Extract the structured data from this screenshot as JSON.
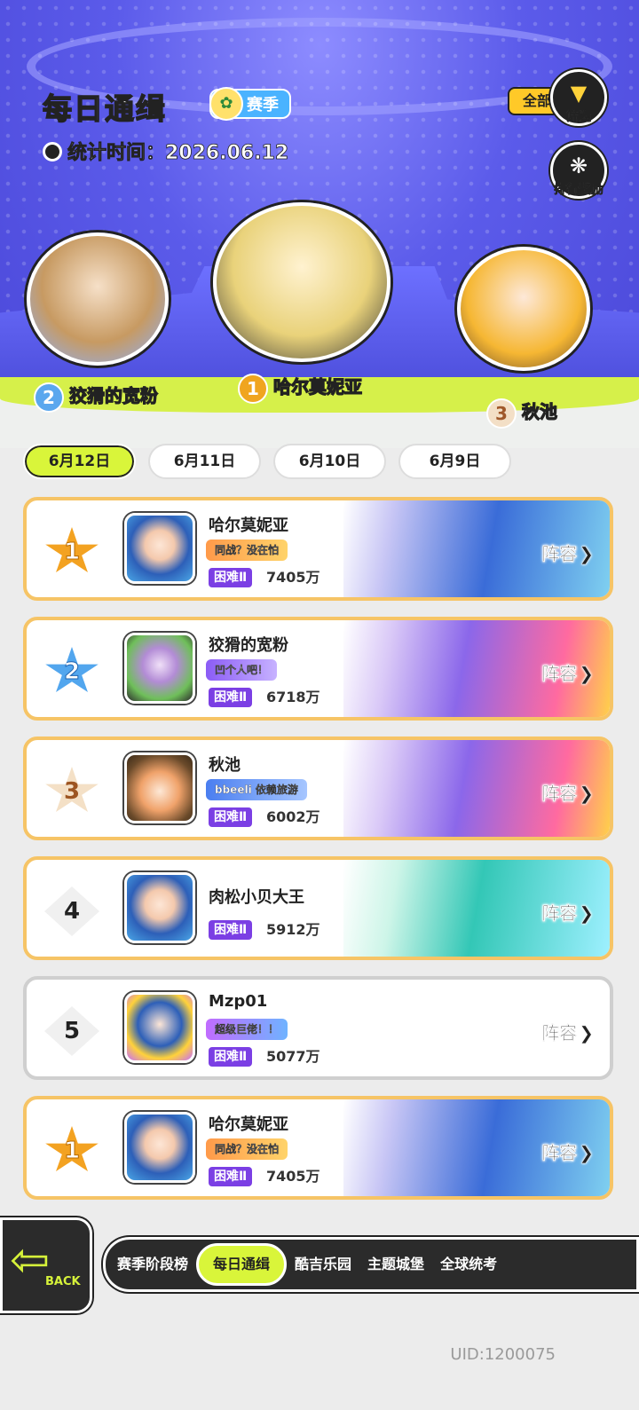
{
  "header": {
    "title": "每日通缉",
    "season_badge": "赛季",
    "stat_time_label": "统计时间：2026.06.12",
    "filter_all": "全部",
    "filter_label": "筛选",
    "reward_label": "排行奖励"
  },
  "podium": [
    {
      "rank": "2",
      "name": "狡猾的宽粉"
    },
    {
      "rank": "1",
      "name": "哈尔莫妮亚"
    },
    {
      "rank": "3",
      "name": "秋池"
    }
  ],
  "date_tabs": [
    "6月12日",
    "6月11日",
    "6月10日",
    "6月9日"
  ],
  "date_tab_active": "6月12日",
  "ranks": [
    {
      "rank": "1",
      "name": "哈尔莫妮亚",
      "tag": "同战？没在怕",
      "difficulty": "困难Ⅱ",
      "score": "7405万",
      "lineup": "阵容"
    },
    {
      "rank": "2",
      "name": "狡猾的宽粉",
      "tag": "凹个人吧！",
      "difficulty": "困难Ⅱ",
      "score": "6718万",
      "lineup": "阵容"
    },
    {
      "rank": "3",
      "name": "秋池",
      "tag": "bbeeli 依赖旅游",
      "difficulty": "困难Ⅱ",
      "score": "6002万",
      "lineup": "阵容"
    },
    {
      "rank": "4",
      "name": "肉松小贝大王",
      "tag": "",
      "difficulty": "困难Ⅱ",
      "score": "5912万",
      "lineup": "阵容"
    },
    {
      "rank": "5",
      "name": "Mzp01",
      "tag": "超级巨佬！！",
      "difficulty": "困难Ⅱ",
      "score": "5077万",
      "lineup": "阵容"
    },
    {
      "rank": "1",
      "name": "哈尔莫妮亚",
      "tag": "同战？没在怕",
      "difficulty": "困难Ⅱ",
      "score": "7405万",
      "lineup": "阵容"
    }
  ],
  "bottom_nav": {
    "back_label": "BACK",
    "items": [
      "赛季阶段榜",
      "每日通缉",
      "酷吉乐园",
      "主题城堡",
      "全球统考"
    ],
    "active": "每日通缉"
  },
  "uid": "UID:1200075",
  "colors": {
    "accent_lime": "#d9f53a",
    "gold": "#f3a221",
    "silver": "#52a6ee",
    "difficulty": "#7b3fe4"
  }
}
